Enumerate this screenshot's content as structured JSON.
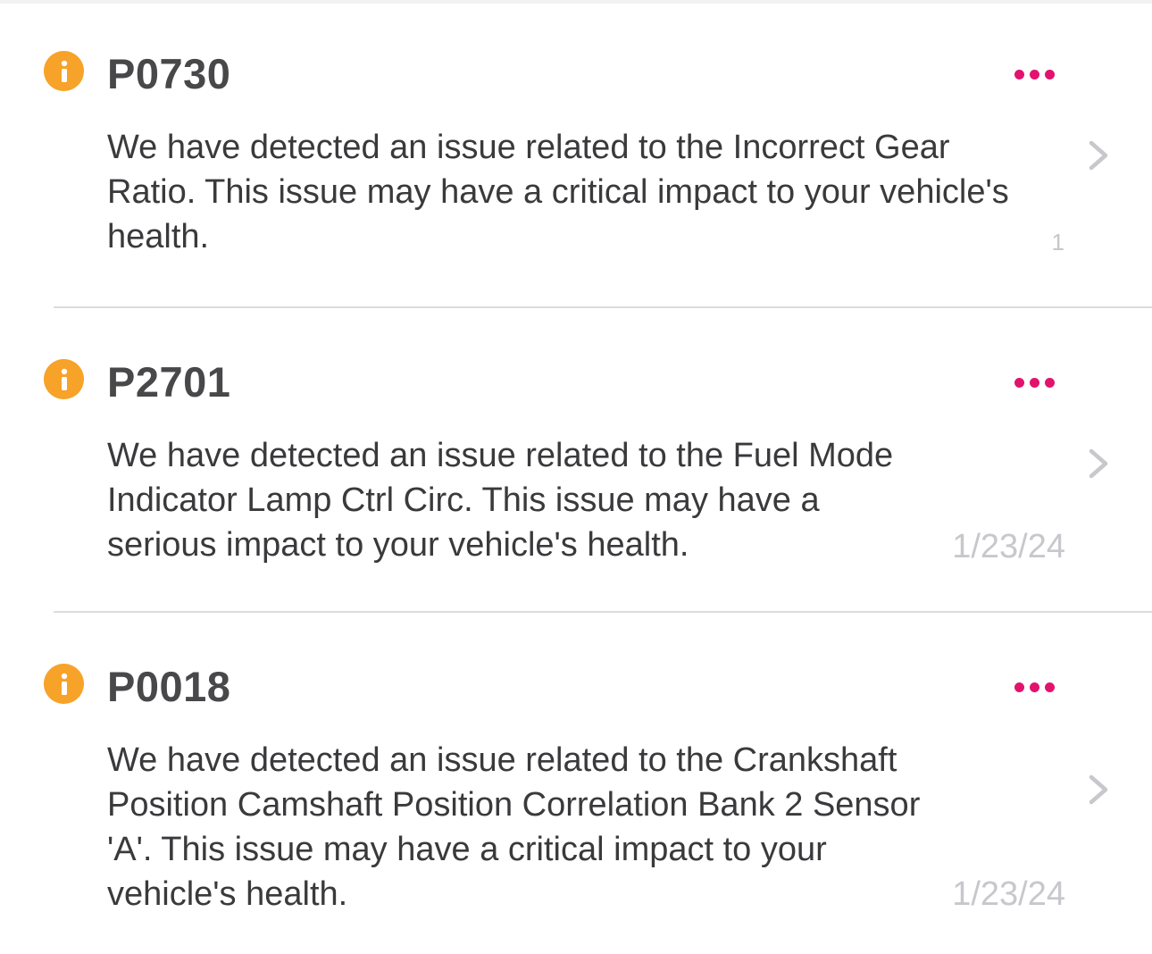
{
  "colors": {
    "warning_icon": "#f7a229",
    "accent": "#e2136e",
    "timestamp": "#c7c7cc"
  },
  "alerts": [
    {
      "icon": "info-icon",
      "code": "P0730",
      "description": "We have detected an issue related to the Incorrect Gear Ratio. This issue may have a critical impact to your vehicle's health.",
      "timestamp": "1",
      "more_icon": "more-horizontal-icon",
      "chevron_icon": "chevron-right-icon"
    },
    {
      "icon": "info-icon",
      "code": "P2701",
      "description": "We have detected an issue related to the Fuel Mode Indicator Lamp Ctrl Circ. This issue may have a serious impact to your vehicle's health.",
      "timestamp": "1/23/24",
      "more_icon": "more-horizontal-icon",
      "chevron_icon": "chevron-right-icon"
    },
    {
      "icon": "info-icon",
      "code": "P0018",
      "description": "We have detected an issue related to the Crankshaft Position Camshaft Position Correlation Bank 2 Sensor 'A'. This issue may have a critical impact to your vehicle's health.",
      "timestamp": "1/23/24",
      "more_icon": "more-horizontal-icon",
      "chevron_icon": "chevron-right-icon"
    }
  ]
}
